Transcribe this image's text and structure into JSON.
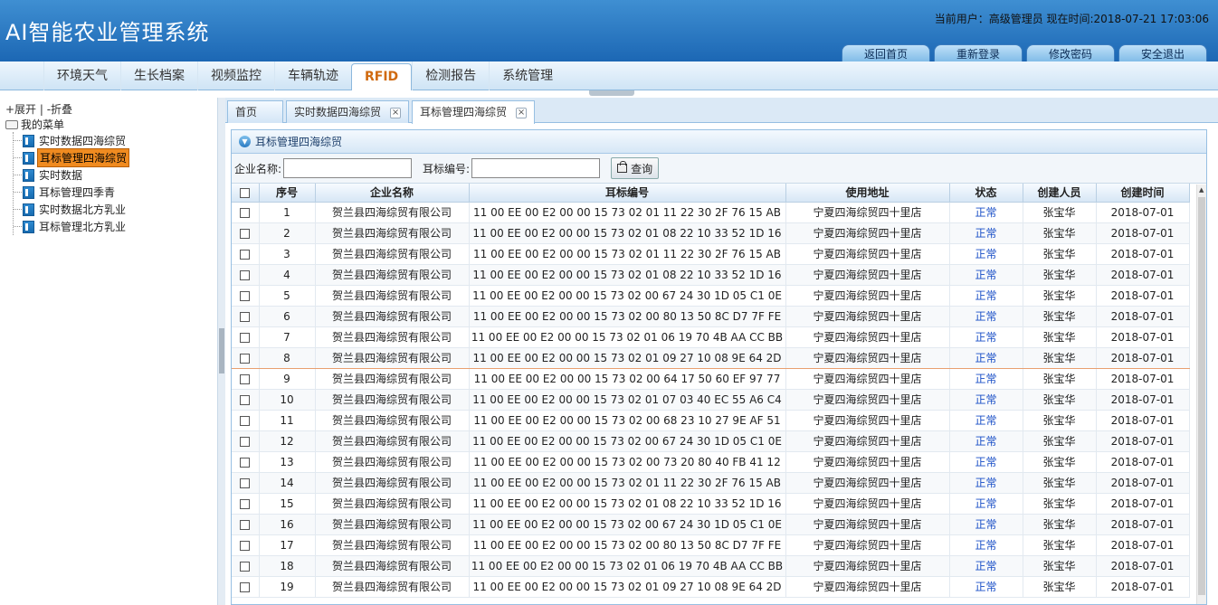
{
  "header": {
    "title": "AI智能农业管理系统",
    "user_info": "当前用户：高级管理员 现在时间:2018-07-21 17:03:06",
    "buttons": [
      "返回首页",
      "重新登录",
      "修改密码",
      "安全退出"
    ]
  },
  "nav": {
    "items": [
      "环境天气",
      "生长档案",
      "视频监控",
      "车辆轨迹",
      "RFID",
      "检测报告",
      "系统管理"
    ],
    "active": "RFID"
  },
  "sidebar": {
    "controls": "+展开 | -折叠",
    "root": "我的菜单",
    "items": [
      "实时数据四海综贸",
      "耳标管理四海综贸",
      "实时数据",
      "耳标管理四季青",
      "实时数据北方乳业",
      "耳标管理北方乳业"
    ],
    "selected": "耳标管理四海综贸"
  },
  "tabs": [
    "首页",
    "实时数据四海综贸",
    "耳标管理四海综贸"
  ],
  "active_tab": "耳标管理四海综贸",
  "panel": {
    "title": "耳标管理四海综贸",
    "search": {
      "company_label": "企业名称:",
      "tag_label": "耳标编号:",
      "button": "查询"
    }
  },
  "table": {
    "columns": [
      "序号",
      "企业名称",
      "耳标编号",
      "使用地址",
      "状态",
      "创建人员",
      "创建时间"
    ],
    "rows": [
      [
        "1",
        "贺兰县四海综贸有限公司",
        "11 00 EE 00 E2 00 00 15 73 02 01 11 22 30 2F 76 15 AB",
        "宁夏四海综贸四十里店",
        "正常",
        "张宝华",
        "2018-07-01"
      ],
      [
        "2",
        "贺兰县四海综贸有限公司",
        "11 00 EE 00 E2 00 00 15 73 02 01 08 22 10 33 52 1D 16",
        "宁夏四海综贸四十里店",
        "正常",
        "张宝华",
        "2018-07-01"
      ],
      [
        "3",
        "贺兰县四海综贸有限公司",
        "11 00 EE 00 E2 00 00 15 73 02 01 11 22 30 2F 76 15 AB",
        "宁夏四海综贸四十里店",
        "正常",
        "张宝华",
        "2018-07-01"
      ],
      [
        "4",
        "贺兰县四海综贸有限公司",
        "11 00 EE 00 E2 00 00 15 73 02 01 08 22 10 33 52 1D 16",
        "宁夏四海综贸四十里店",
        "正常",
        "张宝华",
        "2018-07-01"
      ],
      [
        "5",
        "贺兰县四海综贸有限公司",
        "11 00 EE 00 E2 00 00 15 73 02 00 67 24 30 1D 05 C1 0E",
        "宁夏四海综贸四十里店",
        "正常",
        "张宝华",
        "2018-07-01"
      ],
      [
        "6",
        "贺兰县四海综贸有限公司",
        "11 00 EE 00 E2 00 00 15 73 02 00 80 13 50 8C D7 7F FE",
        "宁夏四海综贸四十里店",
        "正常",
        "张宝华",
        "2018-07-01"
      ],
      [
        "7",
        "贺兰县四海综贸有限公司",
        "11 00 EE 00 E2 00 00 15 73 02 01 06 19 70 4B AA CC BB",
        "宁夏四海综贸四十里店",
        "正常",
        "张宝华",
        "2018-07-01"
      ],
      [
        "8",
        "贺兰县四海综贸有限公司",
        "11 00 EE 00 E2 00 00 15 73 02 01 09 27 10 08 9E 64 2D",
        "宁夏四海综贸四十里店",
        "正常",
        "张宝华",
        "2018-07-01"
      ],
      [
        "9",
        "贺兰县四海综贸有限公司",
        "11 00 EE 00 E2 00 00 15 73 02 00 64 17 50 60 EF 97 77",
        "宁夏四海综贸四十里店",
        "正常",
        "张宝华",
        "2018-07-01"
      ],
      [
        "10",
        "贺兰县四海综贸有限公司",
        "11 00 EE 00 E2 00 00 15 73 02 01 07 03 40 EC 55 A6 C4",
        "宁夏四海综贸四十里店",
        "正常",
        "张宝华",
        "2018-07-01"
      ],
      [
        "11",
        "贺兰县四海综贸有限公司",
        "11 00 EE 00 E2 00 00 15 73 02 00 68 23 10 27 9E AF 51",
        "宁夏四海综贸四十里店",
        "正常",
        "张宝华",
        "2018-07-01"
      ],
      [
        "12",
        "贺兰县四海综贸有限公司",
        "11 00 EE 00 E2 00 00 15 73 02 00 67 24 30 1D 05 C1 0E",
        "宁夏四海综贸四十里店",
        "正常",
        "张宝华",
        "2018-07-01"
      ],
      [
        "13",
        "贺兰县四海综贸有限公司",
        "11 00 EE 00 E2 00 00 15 73 02 00 73 20 80 40 FB 41 12",
        "宁夏四海综贸四十里店",
        "正常",
        "张宝华",
        "2018-07-01"
      ],
      [
        "14",
        "贺兰县四海综贸有限公司",
        "11 00 EE 00 E2 00 00 15 73 02 01 11 22 30 2F 76 15 AB",
        "宁夏四海综贸四十里店",
        "正常",
        "张宝华",
        "2018-07-01"
      ],
      [
        "15",
        "贺兰县四海综贸有限公司",
        "11 00 EE 00 E2 00 00 15 73 02 01 08 22 10 33 52 1D 16",
        "宁夏四海综贸四十里店",
        "正常",
        "张宝华",
        "2018-07-01"
      ],
      [
        "16",
        "贺兰县四海综贸有限公司",
        "11 00 EE 00 E2 00 00 15 73 02 00 67 24 30 1D 05 C1 0E",
        "宁夏四海综贸四十里店",
        "正常",
        "张宝华",
        "2018-07-01"
      ],
      [
        "17",
        "贺兰县四海综贸有限公司",
        "11 00 EE 00 E2 00 00 15 73 02 00 80 13 50 8C D7 7F FE",
        "宁夏四海综贸四十里店",
        "正常",
        "张宝华",
        "2018-07-01"
      ],
      [
        "18",
        "贺兰县四海综贸有限公司",
        "11 00 EE 00 E2 00 00 15 73 02 01 06 19 70 4B AA CC BB",
        "宁夏四海综贸四十里店",
        "正常",
        "张宝华",
        "2018-07-01"
      ],
      [
        "19",
        "贺兰县四海综贸有限公司",
        "11 00 EE 00 E2 00 00 15 73 02 01 09 27 10 08 9E 64 2D",
        "宁夏四海综贸四十里店",
        "正常",
        "张宝华",
        "2018-07-01"
      ]
    ]
  },
  "colors": {
    "header_blue": "#1c67b4",
    "accent_orange": "#d06a10",
    "status_blue": "#1a4fc7"
  }
}
